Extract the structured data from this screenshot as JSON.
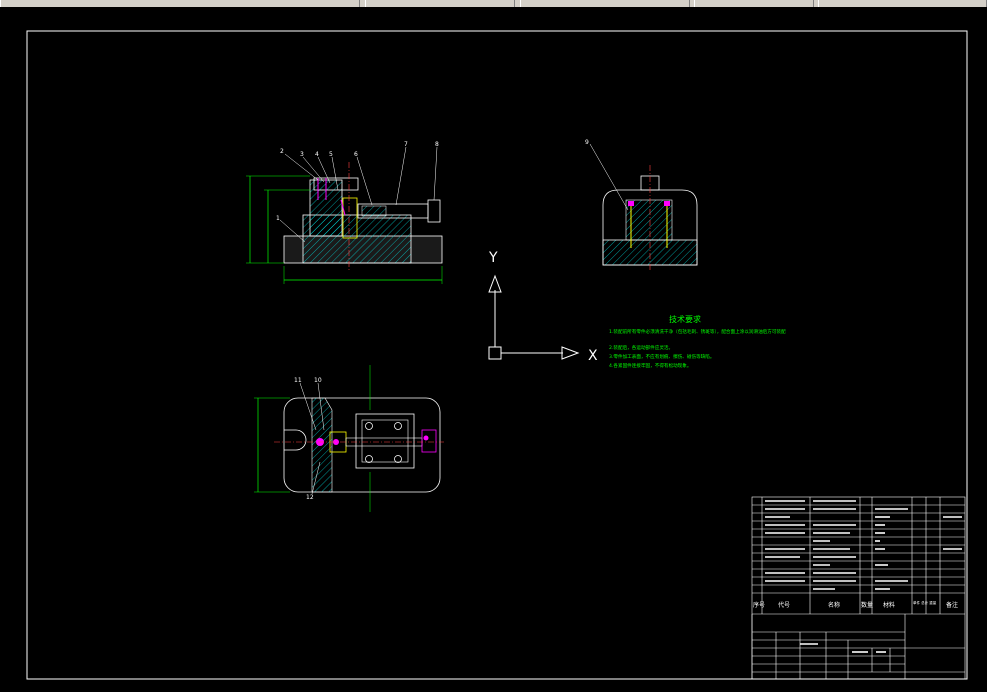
{
  "drawing": {
    "axis_labels": {
      "x": "X",
      "y": "Y"
    },
    "tech_requirements": {
      "title": "技术要求",
      "lines": [
        "1.装配前所有零件必须清洗干净（包括毛刺、锈斑等），配合面上涂以润滑油后方可装配",
        "2.装配后，各运动部件应灵活。",
        "3.零件加工表面，不应有划痕、擦伤、碰伤等缺陷。",
        "4.各紧固件连接牢固，不得有松动现象。"
      ]
    },
    "balloons": {
      "front": [
        "2",
        "3",
        "4",
        "5",
        "6",
        "7",
        "8",
        "1"
      ],
      "side": [
        "9"
      ],
      "top": [
        "11",
        "10",
        "12"
      ]
    },
    "section_label": "A-A",
    "bom_header": {
      "seq": "序号",
      "code": "代号",
      "name": "名称",
      "qty": "数量",
      "material": "材料",
      "weight": "单件 总计 重量",
      "remarks": "备注"
    }
  }
}
